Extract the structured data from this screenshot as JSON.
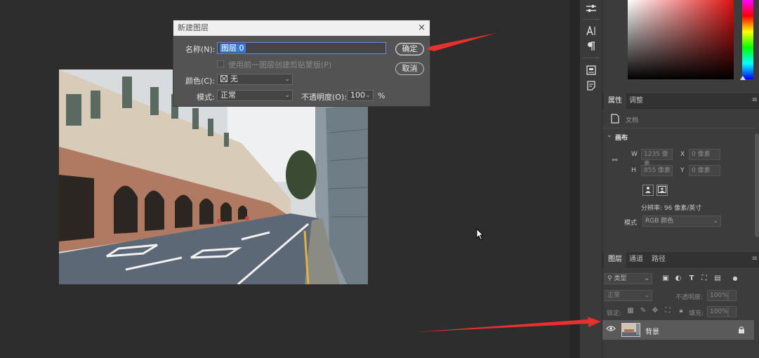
{
  "dialog": {
    "title": "新建图层",
    "close_glyph": "×",
    "name_label": "名称(N):",
    "name_value": "图层 0",
    "clip_label": "使用前一图层创建剪贴蒙版(P)",
    "color_label": "颜色(C):",
    "color_value": "无",
    "mode_label": "模式:",
    "mode_value": "正常",
    "opacity_label": "不透明度(O):",
    "opacity_value": "100",
    "opacity_unit": "%",
    "ok_label": "确定",
    "cancel_label": "取消"
  },
  "properties": {
    "tabs": [
      "属性",
      "调整"
    ],
    "doc_label": "文档",
    "canvas_section": "画布",
    "w_label": "W",
    "w_value": "1235 像素",
    "h_label": "H",
    "h_value": "855 像素",
    "x_label": "X",
    "x_value": "0 像素",
    "y_label": "Y",
    "y_value": "0 像素",
    "resolution": "分辨率: 96 像素/英寸",
    "mode_label": "模式",
    "mode_value": "RGB 颜色"
  },
  "layers": {
    "tabs": [
      "图层",
      "通道",
      "路径"
    ],
    "filter_kind": "类型",
    "blend_mode": "正常",
    "opacity_label": "不透明度:",
    "opacity_value": "100%",
    "lock_label": "锁定:",
    "fill_label": "填充:",
    "fill_value": "100%",
    "layer_name": "背景"
  },
  "colors": {
    "accent_selection": "#3a79d6",
    "arrow": "#e8312f"
  }
}
